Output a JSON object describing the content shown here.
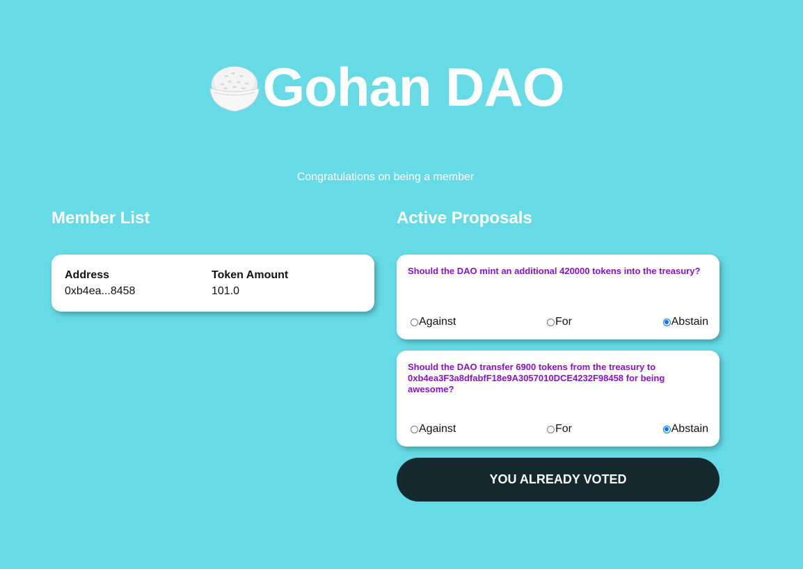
{
  "header": {
    "icon": "rice-bowl-icon",
    "title": "Gohan DAO",
    "subtitle": "Congratulations on being a member"
  },
  "members": {
    "heading": "Member List",
    "columns": [
      "Address",
      "Token Amount"
    ],
    "rows": [
      {
        "address": "0xb4ea...8458",
        "tokens": "101.0"
      }
    ]
  },
  "proposals": {
    "heading": "Active Proposals",
    "items": [
      {
        "question": "Should the DAO mint an additional 420000 tokens into the treasury?",
        "options": [
          "Against",
          "For",
          "Abstain"
        ],
        "selected": "Abstain"
      },
      {
        "question": "Should the DAO transfer 6900 tokens from the treasury to 0xb4ea3F3a8dfabfF18e9A3057010DCE4232F98458 for being awesome?",
        "options": [
          "Against",
          "For",
          "Abstain"
        ],
        "selected": "Abstain"
      }
    ],
    "submit_label": "YOU ALREADY VOTED"
  },
  "colors": {
    "background": "#66dbe6",
    "question_text": "#8a10d8",
    "button_bg": "#142a2e",
    "radio_selected": "#0075ff"
  }
}
